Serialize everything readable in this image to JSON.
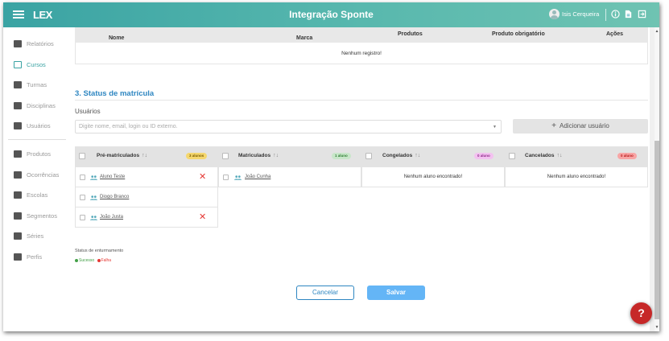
{
  "topbar": {
    "logo": "LEX",
    "title": "Integração Sponte",
    "user": "Isis Cerqueira"
  },
  "sidebar": {
    "items": [
      {
        "label": "Relatórios",
        "icon": "report-icon"
      },
      {
        "label": "Cursos",
        "icon": "courses-icon"
      },
      {
        "label": "Turmas",
        "icon": "groups-icon"
      },
      {
        "label": "Disciplinas",
        "icon": "subjects-icon"
      },
      {
        "label": "Usuários",
        "icon": "user-icon"
      },
      {
        "label": "Produtos",
        "icon": "products-icon"
      },
      {
        "label": "Ocorrências",
        "icon": "warning-icon"
      },
      {
        "label": "Escolas",
        "icon": "school-icon"
      },
      {
        "label": "Segmentos",
        "icon": "tag-icon"
      },
      {
        "label": "Séries",
        "icon": "series-icon"
      },
      {
        "label": "Perfis",
        "icon": "profile-icon"
      }
    ]
  },
  "products_table": {
    "columns": [
      "Nome",
      "Marca",
      "Produtos",
      "Produto obrigatório",
      "Ações"
    ],
    "empty": "Nenhum registro!"
  },
  "status": {
    "title": "3. Status de matrícula",
    "users_label": "Usuários",
    "users_placeholder": "Digite nome, email, login ou ID externo.",
    "add_button": "Adicionar usuário",
    "columns": [
      {
        "label": "Pré-matriculados",
        "badge": "3 alunos",
        "badge_color": "#f5d76e",
        "students": [
          "Aluno Teste",
          "Diogo Branco",
          "João Justa"
        ]
      },
      {
        "label": "Matriculados",
        "badge": "1 aluno",
        "badge_color": "#c8e6c9",
        "students": [
          "João Cunha"
        ]
      },
      {
        "label": "Congelados",
        "badge": "0 aluno",
        "badge_color": "#f3c1f0",
        "empty": "Nenhum aluno encontrado!"
      },
      {
        "label": "Cancelados",
        "badge": "0 aluno",
        "badge_color": "#f8a5a5",
        "empty": "Nenhum aluno encontrado!"
      }
    ],
    "legend_title": "Status de enturmamento",
    "legend_success": "Sucesso",
    "legend_failure": "Falha",
    "success_color": "#43a047",
    "failure_color": "#e53935"
  },
  "actions": {
    "cancel": "Cancelar",
    "save": "Salvar"
  },
  "help": "?"
}
